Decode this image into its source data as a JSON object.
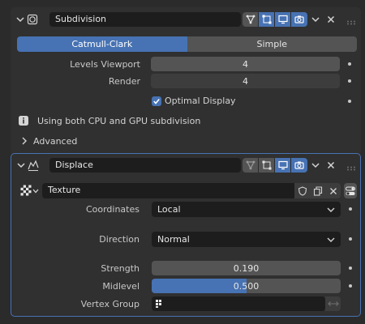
{
  "subdivision": {
    "name": "Subdivision",
    "modes": [
      "Catmull-Clark",
      "Simple"
    ],
    "active_mode": "Catmull-Clark",
    "levels_viewport_label": "Levels Viewport",
    "levels_viewport_value": "4",
    "render_label": "Render",
    "render_value": "4",
    "optimal_display_label": "Optimal Display",
    "optimal_display_checked": true,
    "info_text": "Using both CPU and GPU subdivision",
    "advanced_label": "Advanced"
  },
  "displace": {
    "name": "Displace",
    "texture_name": "Texture",
    "coordinates_label": "Coordinates",
    "coordinates_value": "Local",
    "direction_label": "Direction",
    "direction_value": "Normal",
    "strength_label": "Strength",
    "strength_value": "0.190",
    "midlevel_label": "Midlevel",
    "midlevel_value": "0.500",
    "midlevel_fraction": 0.5,
    "vertex_group_label": "Vertex Group",
    "vertex_group_value": ""
  },
  "colors": {
    "accent": "#4772b3",
    "panel": "#303030",
    "field": "#545454",
    "dark_field": "#1d1d1d"
  }
}
